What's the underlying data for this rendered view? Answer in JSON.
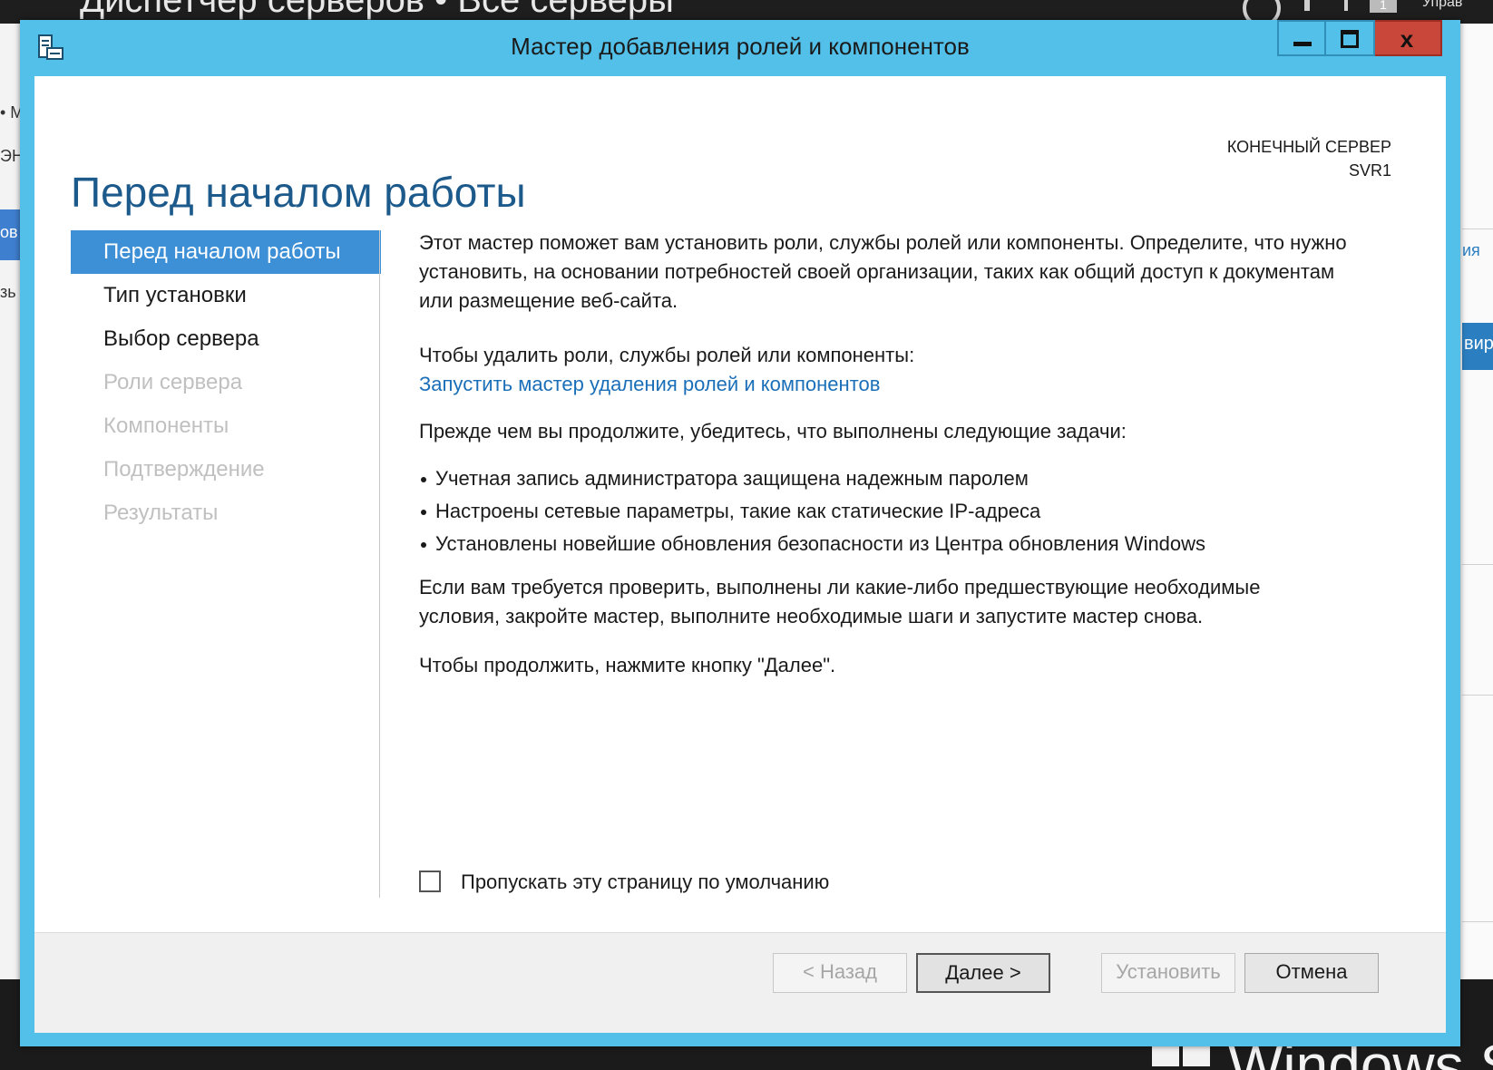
{
  "background": {
    "title": "Диспетчер серверов • Все серверы",
    "badge_count": "1",
    "menu_fragment": "Управ",
    "left_fragments": [
      "• М",
      "ЭН",
      "ов",
      "зь"
    ],
    "right_fragments": [
      "ия",
      "вир"
    ],
    "windows_brand": "Windows Se"
  },
  "window": {
    "title": "Мастер добавления ролей и компонентов",
    "close_glyph": "x"
  },
  "page": {
    "title": "Перед началом работы",
    "destination_label": "КОНЕЧНЫЙ СЕРВЕР",
    "destination_value": "SVR1"
  },
  "nav": {
    "items": [
      {
        "label": "Перед началом работы",
        "state": "active"
      },
      {
        "label": "Тип установки",
        "state": "enabled"
      },
      {
        "label": "Выбор сервера",
        "state": "enabled"
      },
      {
        "label": "Роли сервера",
        "state": "disabled"
      },
      {
        "label": "Компоненты",
        "state": "disabled"
      },
      {
        "label": "Подтверждение",
        "state": "disabled"
      },
      {
        "label": "Результаты",
        "state": "disabled"
      }
    ]
  },
  "content": {
    "intro": "Этот мастер поможет вам установить роли, службы ролей или компоненты. Определите, что нужно установить, на основании потребностей своей организации, таких как общий доступ к документам или размещение веб-сайта.",
    "remove_label": "Чтобы удалить роли, службы ролей или компоненты:",
    "remove_link": "Запустить мастер удаления ролей и компонентов",
    "prereq_heading": "Прежде чем вы продолжите, убедитесь, что выполнены следующие задачи:",
    "bullets": [
      "Учетная запись администратора защищена надежным паролем",
      "Настроены сетевые параметры, такие как статические IP-адреса",
      "Установлены новейшие обновления безопасности из Центра обновления Windows"
    ],
    "verify": "Если вам требуется проверить, выполнены ли какие-либо предшествующие необходимые условия, закройте мастер, выполните необходимые шаги и запустите мастер снова.",
    "continue": "Чтобы продолжить, нажмите кнопку \"Далее\".",
    "skip_label": "Пропускать эту страницу по умолчанию",
    "skip_checked": false
  },
  "buttons": {
    "back": "< Назад",
    "next": "Далее >",
    "install": "Установить",
    "cancel": "Отмена"
  },
  "colors": {
    "title_bar": "#52c0e8",
    "nav_active": "#3d8fd6",
    "link": "#1b6fb8",
    "page_title": "#1d5a8c",
    "close_button": "#c8473a"
  }
}
